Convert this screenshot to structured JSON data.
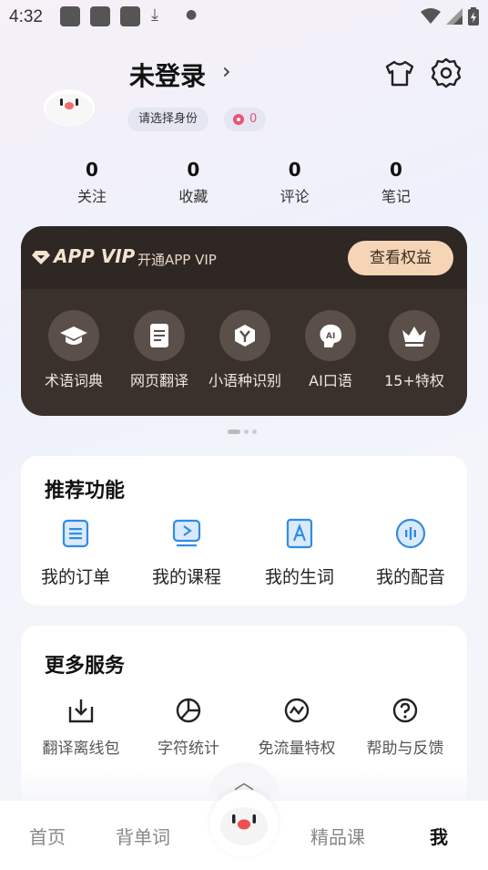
{
  "status_bar": {
    "time": "4:32"
  },
  "profile": {
    "name": "未登录",
    "role_pill": "请选择身份",
    "coins": "0"
  },
  "stats": [
    {
      "value": "0",
      "label": "关注"
    },
    {
      "value": "0",
      "label": "收藏"
    },
    {
      "value": "0",
      "label": "评论"
    },
    {
      "value": "0",
      "label": "笔记"
    }
  ],
  "vip": {
    "brand": "APP VIP",
    "subtitle": "开通APP VIP",
    "button": "查看权益",
    "items": [
      {
        "label": "术语词典",
        "icon": "graduation-cap-icon"
      },
      {
        "label": "网页翻译",
        "icon": "document-icon"
      },
      {
        "label": "小语种识别",
        "icon": "hexagon-y-icon"
      },
      {
        "label": "AI口语",
        "icon": "ai-speech-icon"
      },
      {
        "label": "15+特权",
        "icon": "crown-icon"
      }
    ]
  },
  "recommended": {
    "title": "推荐功能",
    "items": [
      {
        "label": "我的订单",
        "icon": "order-list-icon"
      },
      {
        "label": "我的课程",
        "icon": "course-play-icon"
      },
      {
        "label": "我的生词",
        "icon": "vocabulary-icon"
      },
      {
        "label": "我的配音",
        "icon": "voice-icon"
      }
    ]
  },
  "more_services": {
    "title": "更多服务",
    "items": [
      {
        "label": "翻译离线包",
        "icon": "download-box-icon"
      },
      {
        "label": "字符统计",
        "icon": "pie-chart-icon"
      },
      {
        "label": "免流量特权",
        "icon": "trend-circle-icon"
      },
      {
        "label": "帮助与反馈",
        "icon": "help-icon"
      }
    ]
  },
  "bottom_nav": {
    "items": [
      "首页",
      "背单词",
      "精品课",
      "我"
    ],
    "active": "我"
  },
  "colors": {
    "accent_blue": "#2f8de4",
    "vip_dark": "#3a312d",
    "vip_button": "#f5d5b6",
    "coin_pink": "#e8537a"
  }
}
